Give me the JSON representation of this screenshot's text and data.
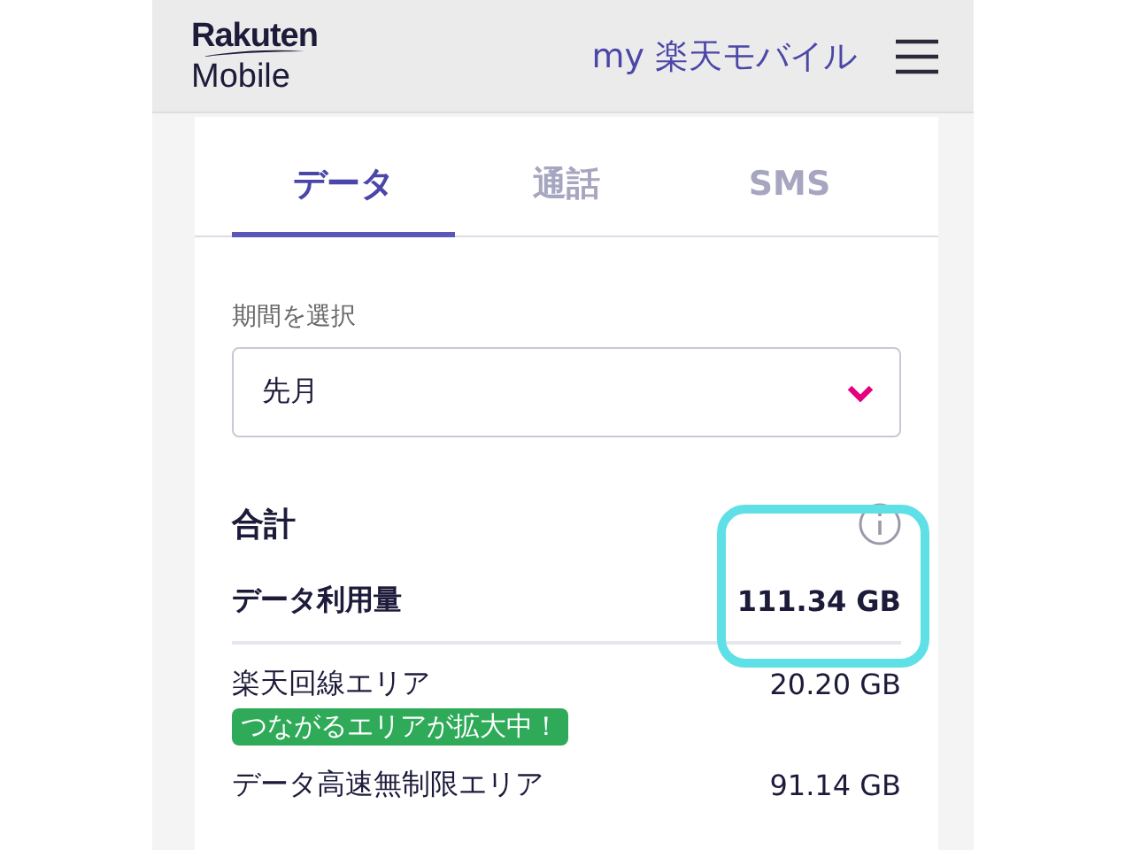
{
  "header": {
    "logo_top": "Rakuten",
    "logo_bottom": "Mobile",
    "title": "my 楽天モバイル"
  },
  "tabs": [
    {
      "label": "データ",
      "selected": true
    },
    {
      "label": "通話",
      "selected": false
    },
    {
      "label": "SMS",
      "selected": false
    }
  ],
  "period": {
    "label": "期間を選択",
    "value": "先月"
  },
  "total": {
    "heading": "合計",
    "label": "データ利用量",
    "value": "111.34 GB"
  },
  "breakdown": [
    {
      "label": "楽天回線エリア",
      "value": "20.20 GB",
      "badge": "つながるエリアが拡大中！"
    },
    {
      "label": "データ高速無制限エリア",
      "value": "91.14 GB"
    }
  ]
}
